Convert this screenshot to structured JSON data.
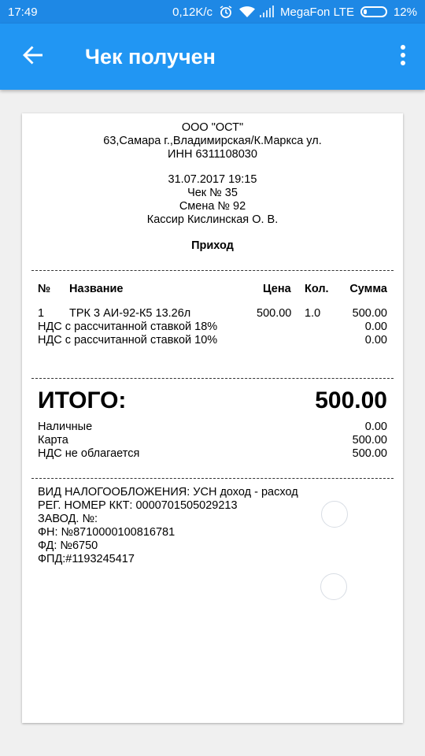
{
  "status_bar": {
    "time": "17:49",
    "speed": "0,12K/c",
    "carrier": "MegaFon LTE",
    "battery": "12%"
  },
  "app_bar": {
    "title": "Чек получен",
    "back_icon": "arrow-back-icon",
    "menu_icon": "more-vert-icon"
  },
  "receipt": {
    "org": "ООО \"ОСТ\"",
    "address": "63,Самара г.,Владимирская/К.Маркса ул.",
    "inn": "ИНН 6311108030",
    "datetime": "31.07.2017 19:15",
    "check_no": "Чек № 35",
    "shift": "Смена № 92",
    "cashier": "Кассир Кислинская О. В.",
    "type": "Приход",
    "columns": {
      "num": "№",
      "name": "Название",
      "price": "Цена",
      "qty": "Кол.",
      "sum": "Сумма"
    },
    "items": [
      {
        "num": "1",
        "name": "ТРК 3 АИ-92-К5 13.26л",
        "price": "500.00",
        "qty": "1.0",
        "sum": "500.00"
      }
    ],
    "vat_lines": [
      {
        "label": "НДС с рассчитанной ставкой 18%",
        "value": "0.00"
      },
      {
        "label": "НДС с рассчитанной ставкой 10%",
        "value": "0.00"
      }
    ],
    "total_label": "ИТОГО:",
    "total_value": "500.00",
    "payments": [
      {
        "label": "Наличные",
        "value": "0.00"
      },
      {
        "label": "Карта",
        "value": "500.00"
      },
      {
        "label": "НДС не облагается",
        "value": "500.00"
      }
    ],
    "footer": [
      "ВИД НАЛОГООБЛОЖЕНИЯ: УСН доход - расход",
      "РЕГ. НОМЕР ККТ: 0000701505029213",
      "ЗАВОД. №:",
      "ФН: №8710000100816781",
      "ФД: №6750",
      "ФПД:#1193245417"
    ]
  }
}
